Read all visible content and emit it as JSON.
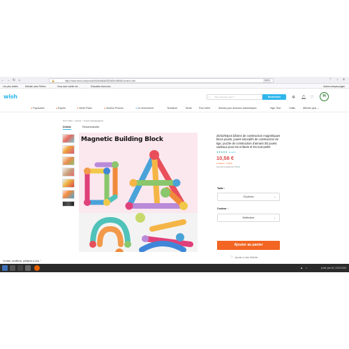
{
  "browser": {
    "url": "https://www.wish.com/product/6166ab8a83f33d82fc4f6b8a?source=cart",
    "zoom": "90 %",
    "bookmarks": [
      "Les plus visités",
      "Débuter avec Firefox",
      "Vous avez oublié vot...",
      "Education.lives.mat..."
    ],
    "other_bookmarks": "Autres marque-pages"
  },
  "header": {
    "logo": "wish",
    "search_placeholder": "Vous cherchez quoi ?",
    "search_button": "Rechercher",
    "avatar_letter": "H"
  },
  "categories": [
    {
      "label": "Populaires",
      "icon": "fire-icon"
    },
    {
      "label": "Exprès",
      "icon": "bolt-icon"
    },
    {
      "label": "Vente Flash",
      "icon": "flash-icon"
    },
    {
      "label": "Section Promos",
      "icon": "tag-icon"
    },
    {
      "label": "Vu récemment",
      "icon": "clock-icon"
    },
    {
      "label": "Tendance",
      "icon": ""
    },
    {
      "label": "Mode",
      "icon": ""
    },
    {
      "label": "Pour bébé",
      "icon": ""
    },
    {
      "label": "Articles pour animaux domestiques",
      "icon": ""
    },
    {
      "label": "High Tech",
      "icon": ""
    },
    {
      "label": "Outils",
      "icon": ""
    },
    {
      "label": "Afficher plus",
      "icon": "chevron-down-icon"
    }
  ],
  "breadcrumb": "Pour bébé > Jouets > Jouets pédagogiques",
  "tabs": [
    "Détails",
    "Recommandés"
  ],
  "product": {
    "image_title": "Magnetic Building Block",
    "title": "25/42/64pcs bâtons de construction magnétiques blocs jouets, jouets éducatifs de construction de tige, puzzle de construction d'aimant 3D jouets cadeaux pour les enfants et les tout-petits",
    "rating_stars": 5,
    "rating_count": "(4 avis)",
    "price": "10,58 €",
    "shipping": "Livraison : 3,99 €",
    "stock": "Les prix incluent la TVA",
    "size_label": "Taille :",
    "size_value": "25 pièces",
    "color_label": "Couleur :",
    "color_value": "Multicolore",
    "add_to_cart": "Ajouter au panier",
    "wishlist": "Ajouter à votre Wishlist"
  },
  "footnote": "Contact, conditions, politiques & plus",
  "taskbar": {
    "clock": "jeudi, juin 15, 10:03 2023"
  }
}
